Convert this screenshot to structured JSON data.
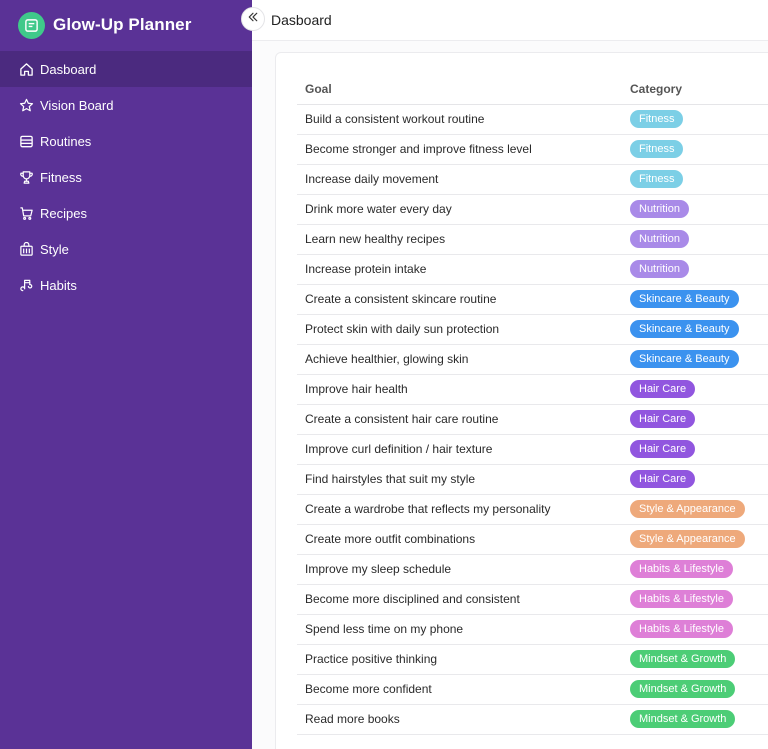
{
  "app": {
    "title": "Glow-Up Planner"
  },
  "sidebar": {
    "items": [
      {
        "label": "Dasboard",
        "icon": "home-icon",
        "active": true
      },
      {
        "label": "Vision Board",
        "icon": "star-icon",
        "active": false
      },
      {
        "label": "Routines",
        "icon": "layers-icon",
        "active": false
      },
      {
        "label": "Fitness",
        "icon": "trophy-icon",
        "active": false
      },
      {
        "label": "Recipes",
        "icon": "cart-icon",
        "active": false
      },
      {
        "label": "Style",
        "icon": "store-icon",
        "active": false
      },
      {
        "label": "Habits",
        "icon": "habit-icon",
        "active": false
      }
    ]
  },
  "header": {
    "title": "Dasboard"
  },
  "table": {
    "columns": [
      "Goal",
      "Category"
    ],
    "rows": [
      {
        "goal": "Build a consistent workout routine",
        "category": "Fitness"
      },
      {
        "goal": "Become stronger and improve fitness level",
        "category": "Fitness"
      },
      {
        "goal": "Increase daily movement",
        "category": "Fitness"
      },
      {
        "goal": "Drink more water every day",
        "category": "Nutrition"
      },
      {
        "goal": "Learn new healthy recipes",
        "category": "Nutrition"
      },
      {
        "goal": "Increase protein intake",
        "category": "Nutrition"
      },
      {
        "goal": "Create a consistent skincare routine",
        "category": "Skincare & Beauty"
      },
      {
        "goal": "Protect skin with daily sun protection",
        "category": "Skincare & Beauty"
      },
      {
        "goal": "Achieve healthier, glowing skin",
        "category": "Skincare & Beauty"
      },
      {
        "goal": "Improve hair health",
        "category": "Hair Care"
      },
      {
        "goal": "Create a consistent hair care routine",
        "category": "Hair Care"
      },
      {
        "goal": "Improve curl definition / hair texture",
        "category": "Hair Care"
      },
      {
        "goal": "Find hairstyles that suit my style",
        "category": "Hair Care"
      },
      {
        "goal": "Create a wardrobe that reflects my personality",
        "category": "Style & Appearance"
      },
      {
        "goal": "Create more outfit combinations",
        "category": "Style & Appearance"
      },
      {
        "goal": "Improve my sleep schedule",
        "category": "Habits & Lifestyle"
      },
      {
        "goal": "Become more disciplined and consistent",
        "category": "Habits & Lifestyle"
      },
      {
        "goal": "Spend less time on my phone",
        "category": "Habits & Lifestyle"
      },
      {
        "goal": "Practice positive thinking",
        "category": "Mindset & Growth"
      },
      {
        "goal": "Become more confident",
        "category": "Mindset & Growth"
      },
      {
        "goal": "Read more books",
        "category": "Mindset & Growth"
      }
    ]
  },
  "category_colors": {
    "Fitness": "#7ccfe6",
    "Nutrition": "#a98ae8",
    "Skincare & Beauty": "#3b92ef",
    "Hair Care": "#9156df",
    "Style & Appearance": "#eea97b",
    "Habits & Lifestyle": "#de7fd7",
    "Mindset & Growth": "#4ccd76"
  },
  "colors": {
    "sidebar_bg": "#5a3296",
    "sidebar_active": "#4b2a7f",
    "brand_logo": "#3fc98a"
  }
}
